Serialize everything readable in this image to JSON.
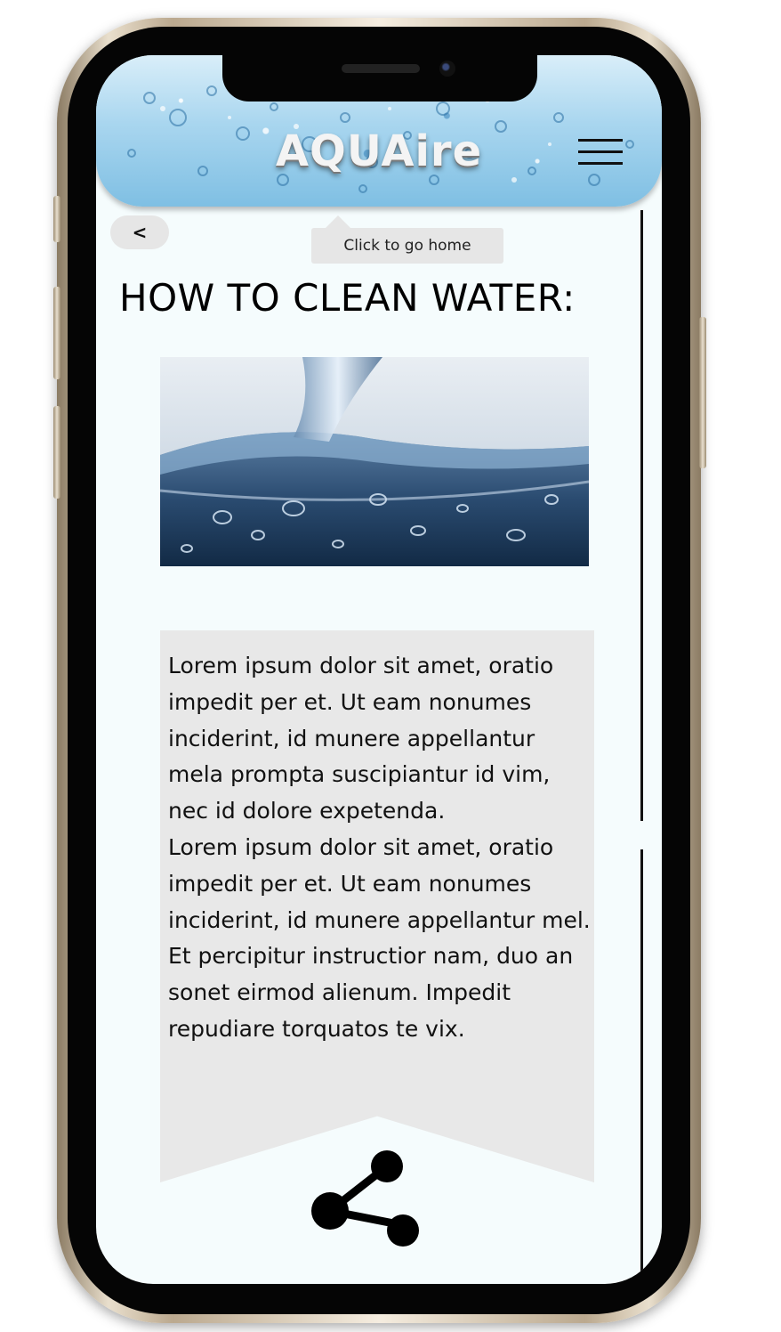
{
  "header": {
    "brand": "AQUAire",
    "menu_icon": "hamburger-menu-icon"
  },
  "nav": {
    "back_label": "<",
    "home_tooltip": "Click to go home"
  },
  "main": {
    "title": "HOW TO CLEAN WATER:",
    "image_subject": "water pouring into glass",
    "paragraphs": [
      "Lorem ipsum dolor sit amet, oratio impedit per et. Ut eam nonumes inciderint, id munere appellantur mela prompta suscipiantur id vim, nec id dolore expetenda.",
      "Lorem ipsum dolor sit amet, oratio impedit per et. Ut eam nonumes inciderint, id munere appellantur mel. Et percipitur instructior nam, duo an sonet eirmod alienum. Impedit repudiare torquatos te vix."
    ],
    "share_icon": "share-icon"
  },
  "colors": {
    "screen_bg": "#f5fcfd",
    "panel_bg": "#e8e8e8",
    "header_water": "#7fbfe3",
    "frame_gold": "#d8c9ae"
  }
}
